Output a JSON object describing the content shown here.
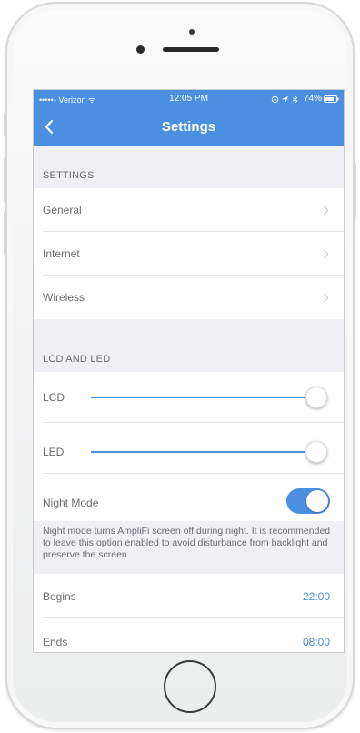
{
  "status": {
    "carrier": "•••••◦ Verizon ᯤ",
    "time": "12:05 PM",
    "battery": "74%"
  },
  "nav": {
    "title": "Settings"
  },
  "sections": {
    "settings_header": "SETTINGS",
    "lcd_led_header": "LCD AND LED"
  },
  "settings_items": [
    {
      "label": "General"
    },
    {
      "label": "Internet"
    },
    {
      "label": "Wireless"
    }
  ],
  "sliders": [
    {
      "label": "LCD",
      "value_fraction": 1.0
    },
    {
      "label": "LED",
      "value_fraction": 1.0
    }
  ],
  "night_mode": {
    "label": "Night Mode",
    "enabled": true,
    "note": "Night mode turns AmpliFi screen off during night. It is recommended to leave this option enabled to avoid disturbance from backlight and preserve the screen."
  },
  "schedule": {
    "begins_label": "Begins",
    "begins_value": "22:00",
    "ends_label": "Ends",
    "ends_value": "08:00"
  },
  "colors": {
    "accent": "#4a8fe0",
    "background": "#efeff4"
  }
}
